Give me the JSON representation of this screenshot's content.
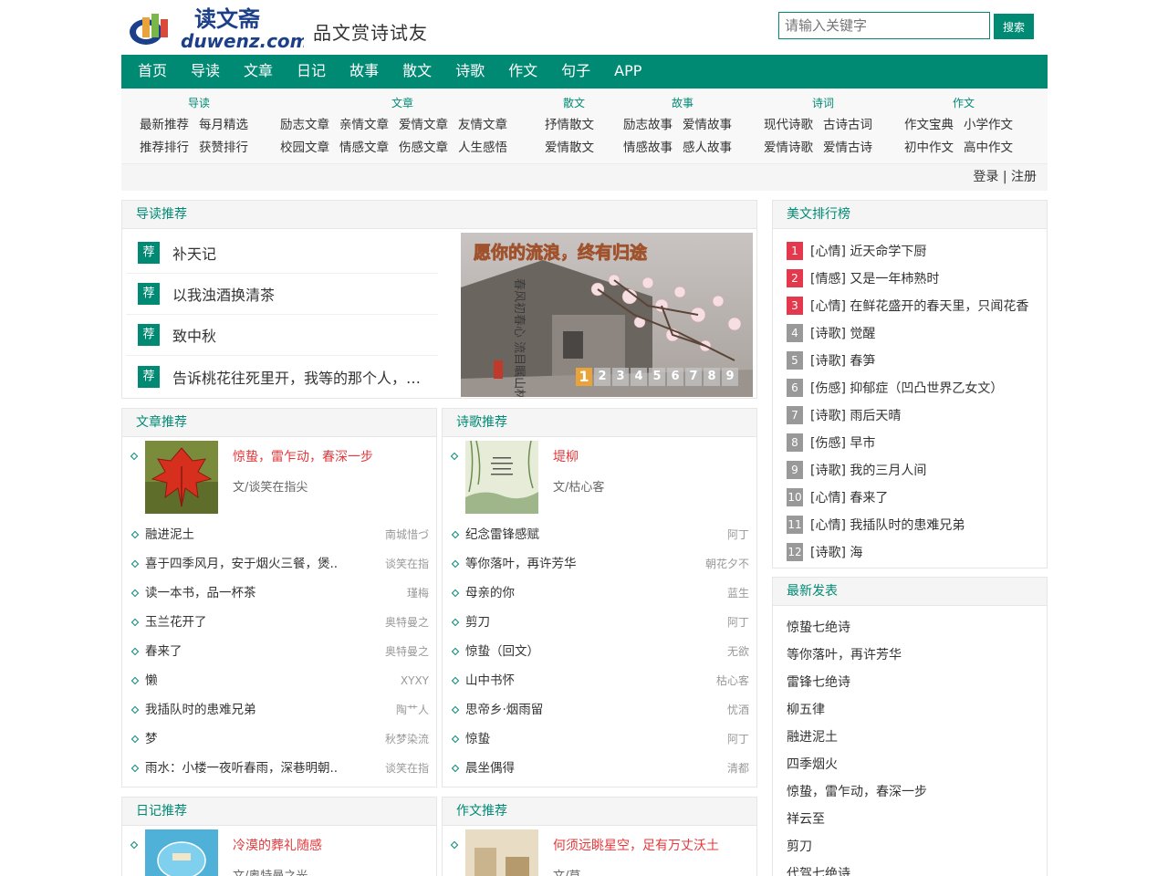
{
  "header": {
    "logo_text_cn": "读文斋",
    "logo_text_en": "duwenz.com",
    "slogan": "品文赏诗试友",
    "search_placeholder": "请输入关键字",
    "search_label": "搜索"
  },
  "nav": [
    "首页",
    "导读",
    "文章",
    "日记",
    "故事",
    "散文",
    "诗歌",
    "作文",
    "句子",
    "APP"
  ],
  "subnav": [
    {
      "title": "导读",
      "rows": [
        [
          "最新推荐",
          "每月精选"
        ],
        [
          "推荐排行",
          "获赞排行"
        ]
      ]
    },
    {
      "title": "文章",
      "rows": [
        [
          "励志文章",
          "亲情文章",
          "爱情文章",
          "友情文章"
        ],
        [
          "校园文章",
          "情感文章",
          "伤感文章",
          "人生感悟"
        ]
      ]
    },
    {
      "title": "散文",
      "rows": [
        [
          "抒情散文"
        ],
        [
          "爱情散文"
        ]
      ]
    },
    {
      "title": "故事",
      "rows": [
        [
          "励志故事",
          "爱情故事"
        ],
        [
          "情感故事",
          "感人故事"
        ]
      ]
    },
    {
      "title": "诗词",
      "rows": [
        [
          "现代诗歌",
          "古诗古词"
        ],
        [
          "爱情诗歌",
          "爱情古诗"
        ]
      ]
    },
    {
      "title": "作文",
      "rows": [
        [
          "作文宝典",
          "小学作文"
        ],
        [
          "初中作文",
          "高中作文"
        ]
      ]
    }
  ],
  "login": {
    "login": "登录",
    "sep": "|",
    "register": "注册"
  },
  "guide": {
    "title": "导读推荐",
    "tag": "荐",
    "items": [
      "补天记",
      "以我浊酒换清茶",
      "致中秋",
      "告诉桃花往死里开，我等的那个人，…"
    ],
    "banner_text": "愿你的流浪，终有归途",
    "banner_poem": "春风初春心 流目瞩山林",
    "dots": [
      "1",
      "2",
      "3",
      "4",
      "5",
      "6",
      "7",
      "8",
      "9"
    ]
  },
  "article": {
    "title": "文章推荐",
    "featured": {
      "title": "惊蛰，雷乍动，春深一步",
      "author": "文/谈笑在指尖"
    },
    "items": [
      {
        "t": "融进泥土",
        "a": "南城惜づ"
      },
      {
        "t": "喜于四季风月，安于烟火三餐，煲..",
        "a": "谈笑在指"
      },
      {
        "t": "读一本书，品一杯茶",
        "a": "瑾梅"
      },
      {
        "t": "玉兰花开了",
        "a": "奥特曼之"
      },
      {
        "t": "春来了",
        "a": "奥特曼之"
      },
      {
        "t": "懒",
        "a": "XYXY"
      },
      {
        "t": "我插队时的患难兄弟",
        "a": "陶艹人"
      },
      {
        "t": "梦",
        "a": "秋梦染流"
      },
      {
        "t": "雨水：小楼一夜听春雨，深巷明朝..",
        "a": "谈笑在指"
      }
    ]
  },
  "poem": {
    "title": "诗歌推荐",
    "featured": {
      "title": "堤柳",
      "author": "文/枯心客"
    },
    "items": [
      {
        "t": "纪念雷锋感赋",
        "a": "阿丁"
      },
      {
        "t": "等你落叶，再许芳华",
        "a": "朝花夕不"
      },
      {
        "t": "母亲的你",
        "a": "蓝生"
      },
      {
        "t": "剪刀",
        "a": "阿丁"
      },
      {
        "t": "惊蛰（回文）",
        "a": "无欲"
      },
      {
        "t": "山中书怀",
        "a": "枯心客"
      },
      {
        "t": "思帝乡·烟雨留",
        "a": "忧酒"
      },
      {
        "t": "惊蛰",
        "a": "阿丁"
      },
      {
        "t": "晨坐偶得",
        "a": "清都"
      }
    ]
  },
  "diary": {
    "title": "日记推荐",
    "featured": {
      "title": "冷漠的葬礼随感",
      "author": "文/奥特曼之光"
    }
  },
  "essay": {
    "title": "作文推荐",
    "featured": {
      "title": "何须远眺星空，足有万丈沃土",
      "author": "文/草"
    }
  },
  "ranking": {
    "title": "美文排行榜",
    "items": [
      {
        "n": "1",
        "c": "[心情]",
        "t": "近天命学下厨"
      },
      {
        "n": "2",
        "c": "[情感]",
        "t": "又是一年柿熟时"
      },
      {
        "n": "3",
        "c": "[心情]",
        "t": "在鲜花盛开的春天里，只闻花香"
      },
      {
        "n": "4",
        "c": "[诗歌]",
        "t": "觉醒"
      },
      {
        "n": "5",
        "c": "[诗歌]",
        "t": "春笋"
      },
      {
        "n": "6",
        "c": "[伤感]",
        "t": "抑郁症（凹凸世界乙女文）"
      },
      {
        "n": "7",
        "c": "[诗歌]",
        "t": "雨后天晴"
      },
      {
        "n": "8",
        "c": "[伤感]",
        "t": "早市"
      },
      {
        "n": "9",
        "c": "[诗歌]",
        "t": "我的三月人间"
      },
      {
        "n": "10",
        "c": "[心情]",
        "t": "春来了"
      },
      {
        "n": "11",
        "c": "[心情]",
        "t": "我插队时的患难兄弟"
      },
      {
        "n": "12",
        "c": "[诗歌]",
        "t": "海"
      }
    ]
  },
  "latest": {
    "title": "最新发表",
    "items": [
      "惊蛰七绝诗",
      "等你落叶，再许芳华",
      "雷锋七绝诗",
      "柳五律",
      "融进泥土",
      "四季烟火",
      "惊蛰，雷乍动，春深一步",
      "祥云至",
      "剪刀",
      "代驾七绝诗"
    ]
  },
  "colors": {
    "brand": "#008a74",
    "hot": "#e4394d",
    "featured_title": "#e4393c"
  }
}
